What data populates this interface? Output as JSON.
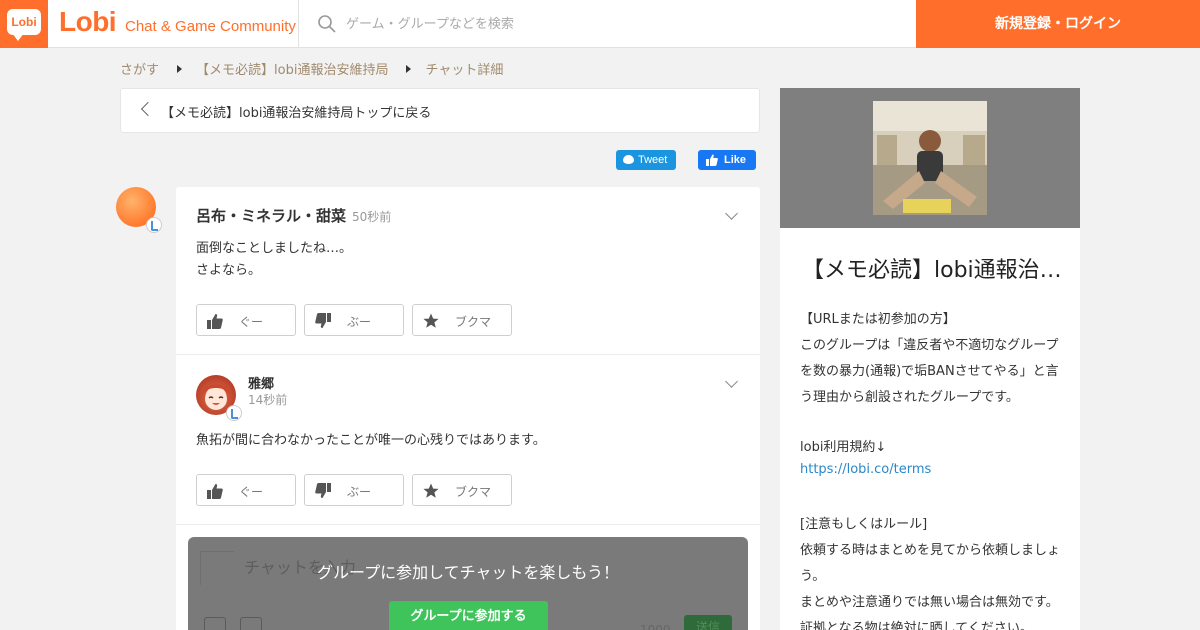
{
  "header": {
    "logo_text": "Lobi",
    "brand": "Lobi",
    "tagline": "Chat & Game Community",
    "search_placeholder": "ゲーム・グループなどを検索",
    "login_label": "新規登録・ログイン"
  },
  "breadcrumb": {
    "items": [
      "さがす",
      "【メモ必読】lobi通報治安維持局",
      "チャット詳細"
    ]
  },
  "back_link": {
    "label": "【メモ必読】lobi通報治安維持局トップに戻る"
  },
  "share": {
    "tweet_label": "Tweet",
    "like_label": "Like"
  },
  "messages": [
    {
      "name": "呂布・ミネラル・甜菜",
      "time": "50秒前",
      "text": "面倒なことしましたね…。\nさよなら。",
      "reactions": [
        "ぐー",
        "ぶー",
        "ブクマ"
      ]
    },
    {
      "name": "雅郷",
      "time": "14秒前",
      "text": "魚拓が間に合わなかったことが唯一の心残りではあります。",
      "reactions": [
        "ぐー",
        "ぶー",
        "ブクマ"
      ]
    }
  ],
  "composer": {
    "placeholder": "チャットを入力",
    "char_count": "1000",
    "send_label": "送信",
    "overlay_text": "グループに参加してチャットを楽しもう！",
    "join_label": "グループに参加する"
  },
  "sidebar": {
    "group_title": "【メモ必読】lobi通報治安維持局",
    "description": [
      "【URLまたは初参加の方】",
      "このグループは「違反者や不適切なグループ",
      "を数の暴力(通報)で垢BANさせてやる」と言",
      "う理由から創設されたグループです。",
      "",
      "lobi利用規約↓",
      "https://lobi.co/terms",
      "",
      "[注意もしくはルール]",
      "依頼する時はまとめを見てから依頼しましょ",
      "う。",
      "まとめや注意通りでは無い場合は無効です。",
      "証拠となる物は絶対に晒してください。"
    ]
  },
  "colors": {
    "brand": "#ff6f2b",
    "join_button": "#3ec45a",
    "link": "#2a88c9",
    "tweet": "#1b95e0",
    "facebook": "#1877f2"
  }
}
